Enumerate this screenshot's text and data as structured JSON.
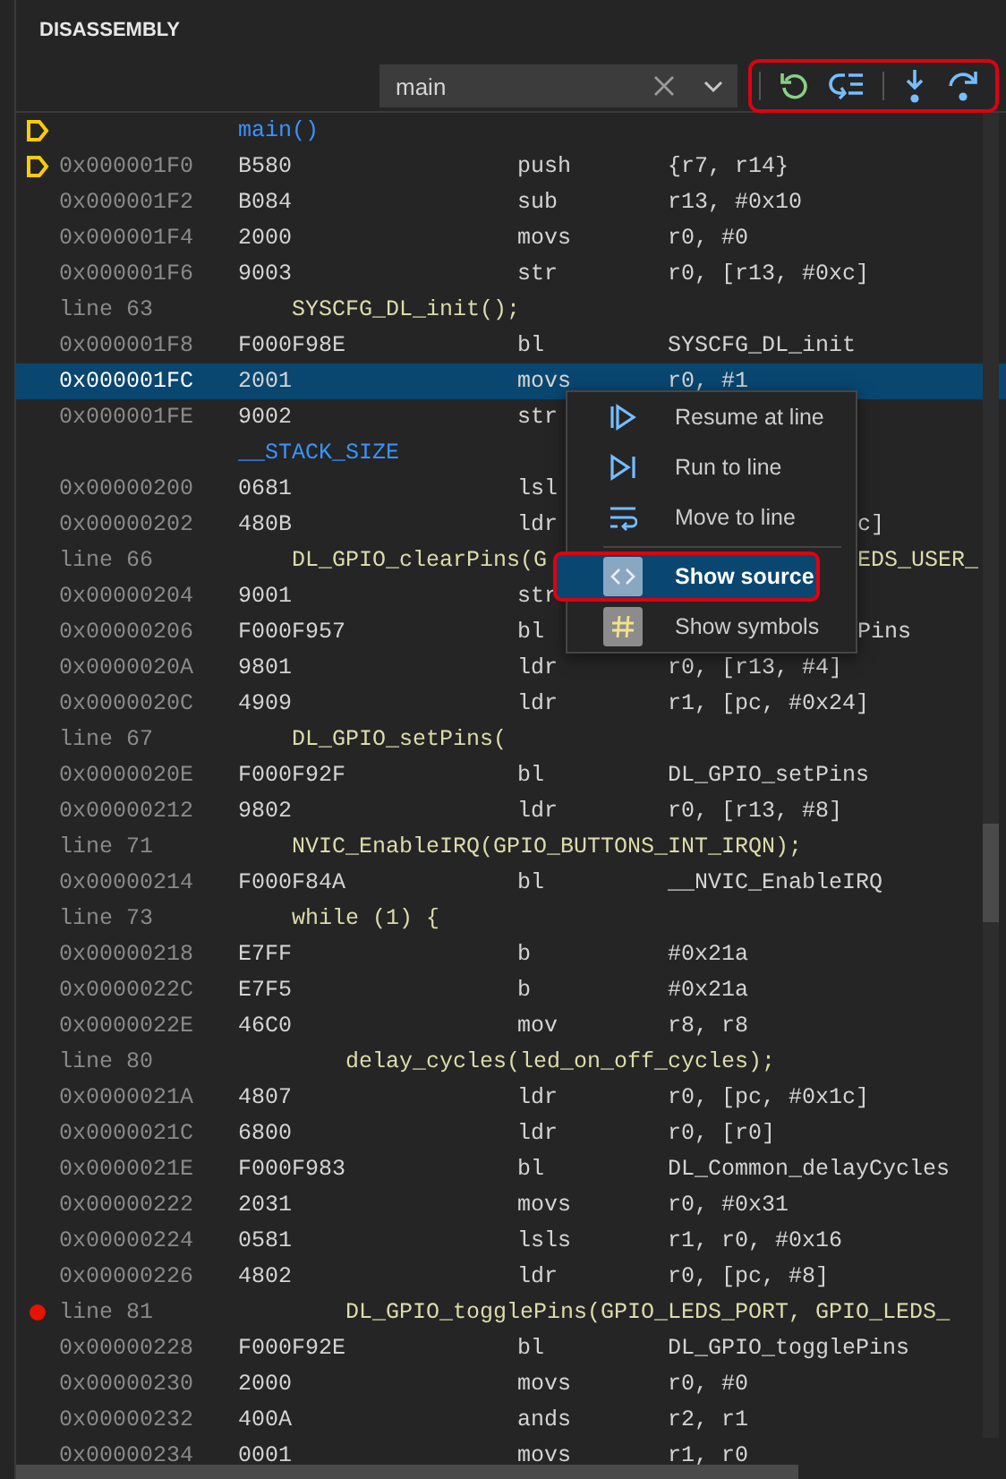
{
  "panel": {
    "title": "DISASSEMBLY"
  },
  "search": {
    "value": "main"
  },
  "toolbar": {
    "highlighted": true
  },
  "rows": [
    {
      "kind": "symbol",
      "frame": true,
      "selected": false,
      "label": "main()"
    },
    {
      "kind": "asm",
      "frame": true,
      "selected": false,
      "address": "0x000001F0",
      "bytes": "B580",
      "mnemonic": "push",
      "operands": "{r7, r14}"
    },
    {
      "kind": "asm",
      "selected": false,
      "address": "0x000001F2",
      "bytes": "B084",
      "mnemonic": "sub",
      "operands": "r13, #0x10"
    },
    {
      "kind": "asm",
      "selected": false,
      "address": "0x000001F4",
      "bytes": "2000",
      "mnemonic": "movs",
      "operands": "r0, #0"
    },
    {
      "kind": "asm",
      "selected": false,
      "address": "0x000001F6",
      "bytes": "9003",
      "mnemonic": "str",
      "operands": "r0, [r13, #0xc]"
    },
    {
      "kind": "source",
      "selected": false,
      "line": "line 63",
      "source": "    SYSCFG_DL_init();"
    },
    {
      "kind": "asm",
      "selected": false,
      "address": "0x000001F8",
      "bytes": "F000F98E",
      "mnemonic": "bl",
      "operands": "SYSCFG_DL_init"
    },
    {
      "kind": "asm",
      "selected": true,
      "address": "0x000001FC",
      "bytes": "2001",
      "mnemonic": "movs",
      "operands": "r0, #1"
    },
    {
      "kind": "asm",
      "selected": false,
      "address": "0x000001FE",
      "bytes": "9002",
      "mnemonic": "str"
    },
    {
      "kind": "symbol",
      "selected": false,
      "label": "__STACK_SIZE"
    },
    {
      "kind": "asm",
      "selected": false,
      "address": "0x00000200",
      "bytes": "0681",
      "mnemonic": "lsl"
    },
    {
      "kind": "asm",
      "selected": false,
      "address": "0x00000202",
      "bytes": "480B",
      "mnemonic": "ldr",
      "tail": "c]"
    },
    {
      "kind": "source",
      "selected": false,
      "line": "line 66",
      "source": "    DL_GPIO_clearPins(G",
      "tail": "EDS_USER_"
    },
    {
      "kind": "asm",
      "selected": false,
      "address": "0x00000204",
      "bytes": "9001",
      "mnemonic": "str"
    },
    {
      "kind": "asm",
      "selected": false,
      "address": "0x00000206",
      "bytes": "F000F957",
      "mnemonic": "bl",
      "tail": "Pins"
    },
    {
      "kind": "asm",
      "selected": false,
      "address": "0x0000020A",
      "bytes": "9801",
      "mnemonic": "ldr",
      "operands": "r0, [r13, #4]"
    },
    {
      "kind": "asm",
      "selected": false,
      "address": "0x0000020C",
      "bytes": "4909",
      "mnemonic": "ldr",
      "operands": "r1, [pc, #0x24]"
    },
    {
      "kind": "source",
      "selected": false,
      "line": "line 67",
      "source": "    DL_GPIO_setPins("
    },
    {
      "kind": "asm",
      "selected": false,
      "address": "0x0000020E",
      "bytes": "F000F92F",
      "mnemonic": "bl",
      "operands": "DL_GPIO_setPins"
    },
    {
      "kind": "asm",
      "selected": false,
      "address": "0x00000212",
      "bytes": "9802",
      "mnemonic": "ldr",
      "operands": "r0, [r13, #8]"
    },
    {
      "kind": "source",
      "selected": false,
      "line": "line 71",
      "source": "    NVIC_EnableIRQ(GPIO_BUTTONS_INT_IRQN);"
    },
    {
      "kind": "asm",
      "selected": false,
      "address": "0x00000214",
      "bytes": "F000F84A",
      "mnemonic": "bl",
      "operands": "__NVIC_EnableIRQ"
    },
    {
      "kind": "source",
      "selected": false,
      "line": "line 73",
      "source": "    while (1) {"
    },
    {
      "kind": "asm",
      "selected": false,
      "address": "0x00000218",
      "bytes": "E7FF",
      "mnemonic": "b",
      "operands": "#0x21a"
    },
    {
      "kind": "asm",
      "selected": false,
      "address": "0x0000022C",
      "bytes": "E7F5",
      "mnemonic": "b",
      "operands": "#0x21a"
    },
    {
      "kind": "asm",
      "selected": false,
      "address": "0x0000022E",
      "bytes": "46C0",
      "mnemonic": "mov",
      "operands": "r8, r8"
    },
    {
      "kind": "source",
      "selected": false,
      "line": "line 80",
      "source": "        delay_cycles(led_on_off_cycles);"
    },
    {
      "kind": "asm",
      "selected": false,
      "address": "0x0000021A",
      "bytes": "4807",
      "mnemonic": "ldr",
      "operands": "r0, [pc, #0x1c]"
    },
    {
      "kind": "asm",
      "selected": false,
      "address": "0x0000021C",
      "bytes": "6800",
      "mnemonic": "ldr",
      "operands": "r0, [r0]"
    },
    {
      "kind": "asm",
      "selected": false,
      "address": "0x0000021E",
      "bytes": "F000F983",
      "mnemonic": "bl",
      "operands": "DL_Common_delayCycles"
    },
    {
      "kind": "asm",
      "selected": false,
      "address": "0x00000222",
      "bytes": "2031",
      "mnemonic": "movs",
      "operands": "r0, #0x31"
    },
    {
      "kind": "asm",
      "selected": false,
      "address": "0x00000224",
      "bytes": "0581",
      "mnemonic": "lsls",
      "operands": "r1, r0, #0x16"
    },
    {
      "kind": "asm",
      "selected": false,
      "address": "0x00000226",
      "bytes": "4802",
      "mnemonic": "ldr",
      "operands": "r0, [pc, #8]"
    },
    {
      "kind": "source",
      "breakpoint": true,
      "selected": false,
      "line": "line 81",
      "source": "        DL_GPIO_togglePins(GPIO_LEDS_PORT, GPIO_LEDS_"
    },
    {
      "kind": "asm",
      "selected": false,
      "address": "0x00000228",
      "bytes": "F000F92E",
      "mnemonic": "bl",
      "operands": "DL_GPIO_togglePins"
    },
    {
      "kind": "asm",
      "selected": false,
      "address": "0x00000230",
      "bytes": "2000",
      "mnemonic": "movs",
      "operands": "r0, #0"
    },
    {
      "kind": "asm",
      "selected": false,
      "address": "0x00000232",
      "bytes": "400A",
      "mnemonic": "ands",
      "operands": "r2, r1"
    },
    {
      "kind": "asm",
      "selected": false,
      "address": "0x00000234",
      "bytes": "0001",
      "mnemonic": "movs",
      "operands": "r1, r0"
    }
  ],
  "context_menu": {
    "items": [
      {
        "kind": "resume",
        "label": "Resume at line",
        "selected": false,
        "highlighted": false,
        "separator_after": false
      },
      {
        "kind": "run",
        "label": "Run to line",
        "selected": false,
        "highlighted": false,
        "separator_after": false
      },
      {
        "kind": "move",
        "label": "Move to line",
        "selected": false,
        "highlighted": false,
        "separator_after": true
      },
      {
        "kind": "source",
        "label": "Show source",
        "selected": true,
        "highlighted": true,
        "separator_after": false
      },
      {
        "kind": "symbols",
        "label": "Show symbols",
        "selected": false,
        "highlighted": false,
        "separator_after": false
      }
    ]
  }
}
